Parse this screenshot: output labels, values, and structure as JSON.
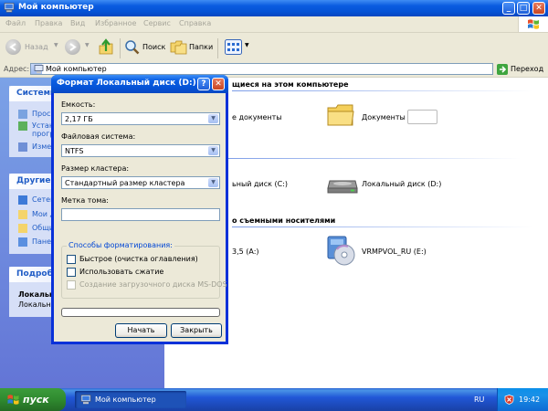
{
  "window": {
    "title": "Мой компьютер",
    "controls": {
      "minimize": "_",
      "maximize": "□",
      "close": "✕"
    }
  },
  "menu": [
    "Файл",
    "Правка",
    "Вид",
    "Избранное",
    "Сервис",
    "Справка"
  ],
  "toolbar": {
    "back": "Назад",
    "search": "Поиск",
    "folders": "Папки"
  },
  "address": {
    "label": "Адрес:",
    "value": "Мой компьютер",
    "go": "Переход"
  },
  "left_pane": {
    "system_tasks": {
      "title": "Системн",
      "items": [
        "Просм",
        "Устан",
        "прогр",
        "Измен"
      ]
    },
    "other_places": {
      "title": "Другие м",
      "items": [
        "Сетев",
        "Мои д",
        "Общи",
        "Пане"
      ]
    },
    "details": {
      "title": "Подробн",
      "name": "Локальн",
      "subtitle": "Локальн"
    }
  },
  "content": {
    "section_stored": "щиеся на этом компьютере",
    "shared_docs": "е документы",
    "docs_item": "Документы -",
    "section_disks": "и",
    "disk_c": "ьный диск (C:)",
    "disk_d": "Локальный диск (D:)",
    "section_removable": "о съемными носителями",
    "floppy": "3,5 (A:)",
    "cd_drive": "VRMPVOL_RU (E:)"
  },
  "dialog": {
    "title": "Формат Локальный диск (D:)",
    "help_btn": "?",
    "close_btn": "✕",
    "capacity_label": "Емкость:",
    "capacity_value": "2,17 ГБ",
    "fs_label": "Файловая система:",
    "fs_value": "NTFS",
    "cluster_label": "Размер кластера:",
    "cluster_value": "Стандартный размер кластера",
    "volume_label": "Метка тома:",
    "volume_value": "",
    "options_title": "Способы форматирования:",
    "quick_format": "Быстрое (очистка оглавления)",
    "compression": "Использовать сжатие",
    "msdos_disk": "Создание загрузочного диска MS-DOS",
    "progress": 0,
    "start": "Начать",
    "close": "Закрыть"
  },
  "taskbar": {
    "start": "пуск",
    "task": "Мой компьютер",
    "lang": "RU",
    "clock": "19:42"
  },
  "colors": {
    "xp_blue": "#0553d6",
    "task_pane": "#6375d6",
    "link": "#215dc6",
    "start_green": "#2f8a2f"
  }
}
